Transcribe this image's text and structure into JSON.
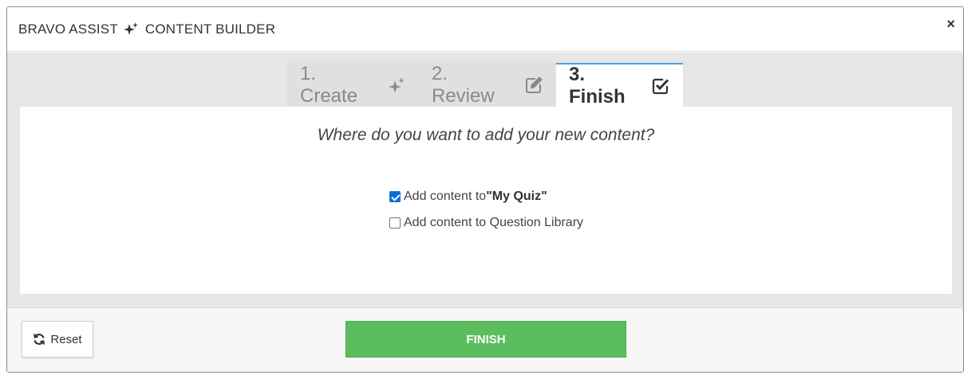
{
  "header": {
    "title_part1": "BRAVO ASSIST",
    "title_part2": "CONTENT BUILDER",
    "close_label": "×"
  },
  "tabs": [
    {
      "label": "1. Create",
      "icon": "sparkle-icon",
      "active": false
    },
    {
      "label": "2. Review",
      "icon": "edit-icon",
      "active": false
    },
    {
      "label": "3. Finish",
      "icon": "check-square-icon",
      "active": true
    }
  ],
  "panel": {
    "question": "Where do you want to add your new content?",
    "options": [
      {
        "prefix": "Add content to ",
        "bold": "\"My Quiz\"",
        "checked": true
      },
      {
        "prefix": "Add content to Question Library",
        "bold": "",
        "checked": false
      }
    ]
  },
  "footer": {
    "reset_label": "Reset",
    "finish_label": "FINISH"
  },
  "colors": {
    "accent_blue": "#4a9fde",
    "finish_green": "#5cbd5e",
    "checkbox_blue": "#0b6fd6"
  }
}
